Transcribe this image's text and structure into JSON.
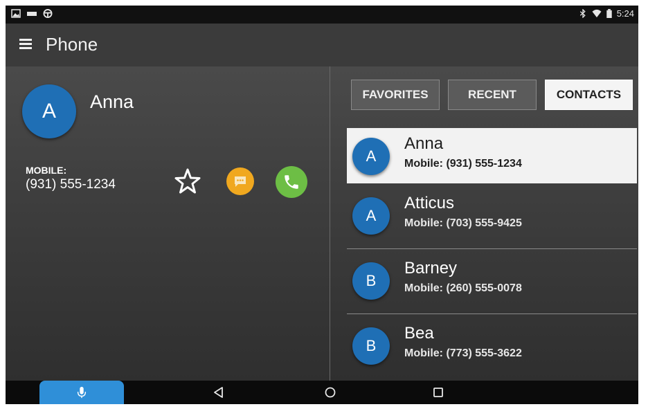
{
  "status_bar": {
    "left_icons": [
      "image-icon",
      "fm-radio-icon",
      "steering-wheel-icon"
    ],
    "right_icons": [
      "bluetooth-icon",
      "wifi-icon",
      "battery-icon"
    ],
    "time": "5:24"
  },
  "app_bar": {
    "menu_icon": "hamburger-menu-icon",
    "title": "Phone"
  },
  "detail": {
    "avatar_initial": "A",
    "name": "Anna",
    "phone_label": "MOBILE:",
    "phone_number": "(931) 555-1234",
    "actions": [
      "star-icon",
      "message-icon",
      "phone-call-icon"
    ]
  },
  "tabs": [
    {
      "label": "FAVORITES",
      "active": false
    },
    {
      "label": "RECENT",
      "active": false
    },
    {
      "label": "CONTACTS",
      "active": true
    }
  ],
  "contacts": [
    {
      "initial": "A",
      "name": "Anna",
      "phone": "Mobile:  (931) 555-1234",
      "selected": true
    },
    {
      "initial": "A",
      "name": "Atticus",
      "phone": "Mobile:  (703) 555-9425",
      "selected": false
    },
    {
      "initial": "B",
      "name": "Barney",
      "phone": "Mobile:  (260) 555-0078",
      "selected": false
    },
    {
      "initial": "B",
      "name": "Bea",
      "phone": "Mobile:  (773) 555-3622",
      "selected": false
    }
  ],
  "nav_bar": {
    "buttons": [
      "microphone-icon",
      "back-icon",
      "home-icon",
      "recents-icon"
    ]
  },
  "colors": {
    "avatar_blue": "#1f6fb5",
    "message_orange": "#f0a81f",
    "call_green": "#6dbe45",
    "voice_blue": "#2f8fd8"
  }
}
